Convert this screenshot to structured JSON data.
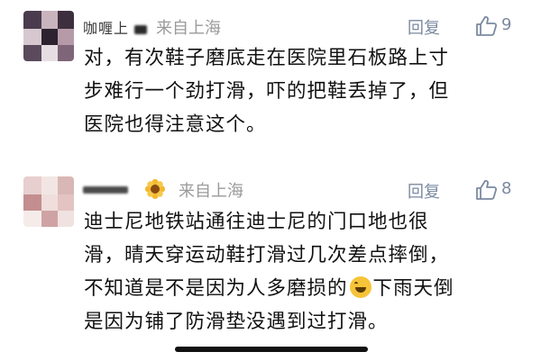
{
  "comments": [
    {
      "username": "咖喱上",
      "location": "来自上海",
      "reply_label": "回复",
      "likes": "9",
      "lines": [
        "对，有次鞋子磨底走在医院里石板路上寸",
        "步难行一个劲打滑，吓的把鞋丢掉了，但",
        "医院也得注意这个。"
      ]
    },
    {
      "location": "来自上海",
      "reply_label": "回复",
      "likes": "8",
      "lines": [
        "迪士尼地铁站通往迪士尼的门口地也很",
        "滑，晴天穿运动鞋打滑过几次差点摔倒，",
        "不知道是不是因为人多磨损的",
        "下雨天倒",
        "是因为铺了防滑垫没遇到过打滑。"
      ]
    }
  ],
  "icons": {
    "like": "thumbs-up-icon",
    "emoji": "laughing-tears-emoji-icon",
    "flower": "sunflower-icon"
  },
  "colors": {
    "meta": "#7b8aa0",
    "location": "#9a9a9a",
    "text": "#111111"
  }
}
